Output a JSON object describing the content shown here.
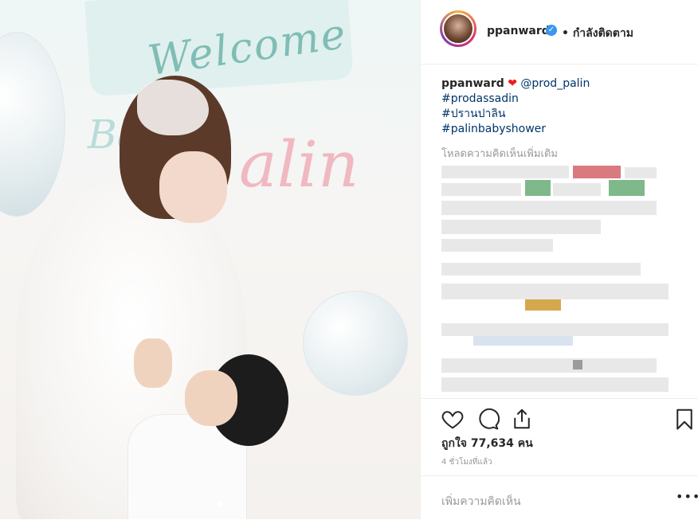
{
  "post": {
    "username": "ppanward",
    "follow_status": "• กำลังติดตาม",
    "verified_icon": "verified-badge-icon"
  },
  "photo": {
    "banner_text": "Welcome",
    "partial_text_left": "Ba",
    "partial_text_right": "alin",
    "carousel_dots": 6,
    "active_dot": 3
  },
  "caption": {
    "username": "ppanward",
    "heart": "❤",
    "mention": "@prod_palin",
    "tags": [
      "#prodassadin",
      "#ปรานปาลิน",
      "#palinbabyshower"
    ]
  },
  "comments": {
    "load_more": "โหลดความคิดเห็นเพิ่มเติม"
  },
  "actions": {
    "like_icon": "heart-outline-icon",
    "comment_icon": "comment-bubble-icon",
    "share_icon": "share-icon",
    "save_icon": "bookmark-icon"
  },
  "likes_text": "ถูกใจ 77,634 คน",
  "time_text": "4 ชั่วโมงที่แล้ว",
  "add_comment": {
    "placeholder": "เพิ่มความคิดเห็น",
    "more_icon": "•••"
  },
  "colors": {
    "link": "#003569",
    "verified": "#3897f0",
    "heart": "#ed1c24"
  }
}
